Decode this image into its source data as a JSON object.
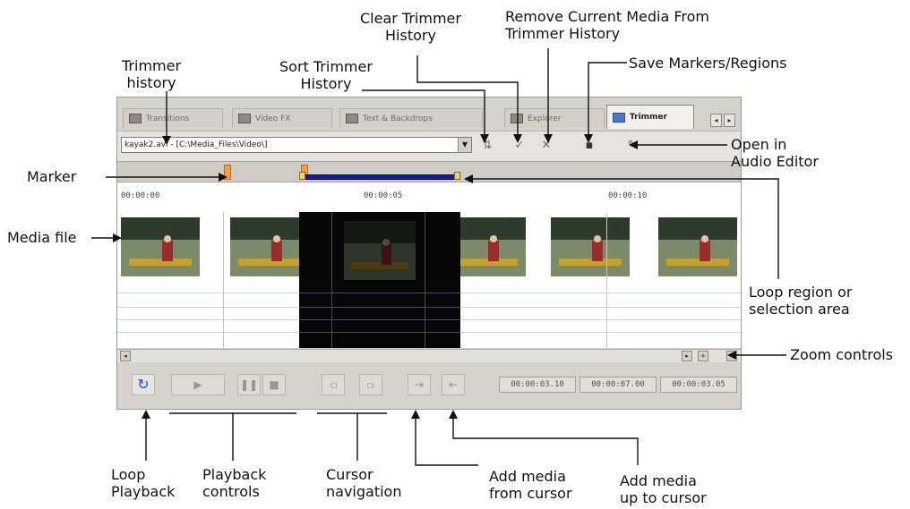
{
  "tabs": [
    {
      "label": "Transitions",
      "active": false
    },
    {
      "label": "Video FX",
      "active": false
    },
    {
      "label": "Text & Backdrops",
      "active": false
    },
    {
      "label": "Explorer",
      "active": false
    },
    {
      "label": "Trimmer",
      "active": true
    }
  ],
  "toolbar": {
    "history_value": "kayak2.avi - [C:\\Media_Files\\Video\\]",
    "icons": [
      "sort-history-icon",
      "clear-history-icon",
      "remove-media-icon",
      "save-markers-icon",
      "open-audio-editor-icon"
    ]
  },
  "ruler": {
    "labels": [
      "00:00:00",
      "00:00:05",
      "00:00:10"
    ]
  },
  "controls": {
    "times": [
      "00:00:03.10",
      "00:00:07.00",
      "00:00:03.05"
    ]
  },
  "callouts": {
    "trimmer_history": "Trimmer\nhistory",
    "sort_history": "Sort Trimmer\nHistory",
    "clear_history": "Clear Trimmer\nHistory",
    "remove_media": "Remove Current Media From\nTrimmer History",
    "save_markers": "Save Markers/Regions",
    "open_audio": "Open in\nAudio Editor",
    "marker": "Marker",
    "media_file": "Media file",
    "loop_region": "Loop region or\nselection area",
    "zoom": "Zoom controls",
    "loop_playback": "Loop\nPlayback",
    "playback_controls": "Playback\ncontrols",
    "cursor_nav": "Cursor\nnavigation",
    "add_from": "Add media\nfrom cursor",
    "add_upto": "Add media\nup to cursor"
  },
  "colors": {
    "selection": "#060606",
    "loop_bar": "#1a1a9a",
    "marker": "#f0a04a",
    "loop_button": "#1f4fd6"
  }
}
